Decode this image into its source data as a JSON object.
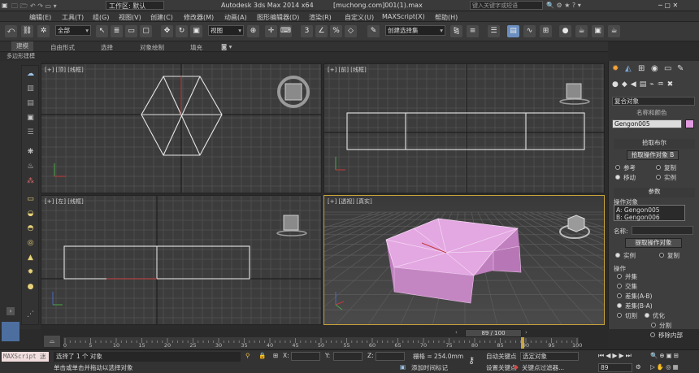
{
  "titlebar": {
    "workspace_label": "工作区: 默认",
    "app_title": "Autodesk 3ds Max  2014 x64",
    "file_title": "[muchong.com]001(1).max",
    "search_placeholder": "键入关键字或短语"
  },
  "menubar": [
    "编辑(E)",
    "工具(T)",
    "组(G)",
    "视图(V)",
    "创建(C)",
    "修改器(M)",
    "动画(A)",
    "图形编辑器(D)",
    "渲染(R)",
    "自定义(U)",
    "MAXScript(X)",
    "帮助(H)"
  ],
  "toolbar": {
    "selection_filter": "全部",
    "ref_coord": "视图",
    "named_selection": "创建选择集"
  },
  "ribbon": {
    "tabs": [
      "建模",
      "自由形式",
      "选择",
      "对象绘制",
      "填充"
    ],
    "sub_label": "多边形建模"
  },
  "viewports": {
    "top": "[+] [顶] [线框]",
    "front": "[+] [前] [线框]",
    "left": "[+] [左] [线框]",
    "perspective": "[+] [透视] [真实]"
  },
  "command_panel": {
    "object_type": "复合对象",
    "name_color_label": "名称和颜色",
    "object_name": "Gengon005",
    "pick_boolean_title": "拾取布尔",
    "pick_operand_button": "拾取操作对象 B",
    "pick_options": [
      "参考",
      "复制",
      "移动",
      "实例"
    ],
    "params_title": "参数",
    "operands_label": "操作对象",
    "operands": [
      "A: Gengon005",
      "B: Gengon006"
    ],
    "name_label": "名称:",
    "extract_button": "提取操作对象",
    "extract_options": [
      "实例",
      "复制"
    ],
    "operation_label": "操作",
    "operations": [
      "并集",
      "交集",
      "差集(A-B)",
      "差集(B-A)",
      "切割"
    ],
    "cut_options": [
      "优化",
      "分割",
      "移除内部"
    ]
  },
  "timeline": {
    "slider_label": "89 / 100",
    "ticks": [
      "0",
      "5",
      "10",
      "15",
      "20",
      "25",
      "30",
      "35",
      "40",
      "45",
      "50",
      "55",
      "60",
      "65",
      "70",
      "75",
      "80",
      "85",
      "90",
      "95",
      "100"
    ]
  },
  "status": {
    "maxscript_label": "MAXScript 迷",
    "selected_text": "选择了 1 个 对象",
    "prompt_text": "单击或单击并拖动以选择对象",
    "x_label": "X:",
    "y_label": "Y:",
    "z_label": "Z:",
    "grid_label": "栅格 = 254.0mm",
    "auto_key": "自动关键点",
    "set_key": "设置关键点",
    "key_mode": "选定对象",
    "key_filters": "关键点过滤器...",
    "add_time_tag": "添加时间标记",
    "frame_value": "89"
  },
  "colors": {
    "object_swatch": "#e39be0",
    "viewport_bg": "#3c3c3c",
    "active_border": "#c9a43a",
    "mesh_fill": "#d892d6"
  }
}
